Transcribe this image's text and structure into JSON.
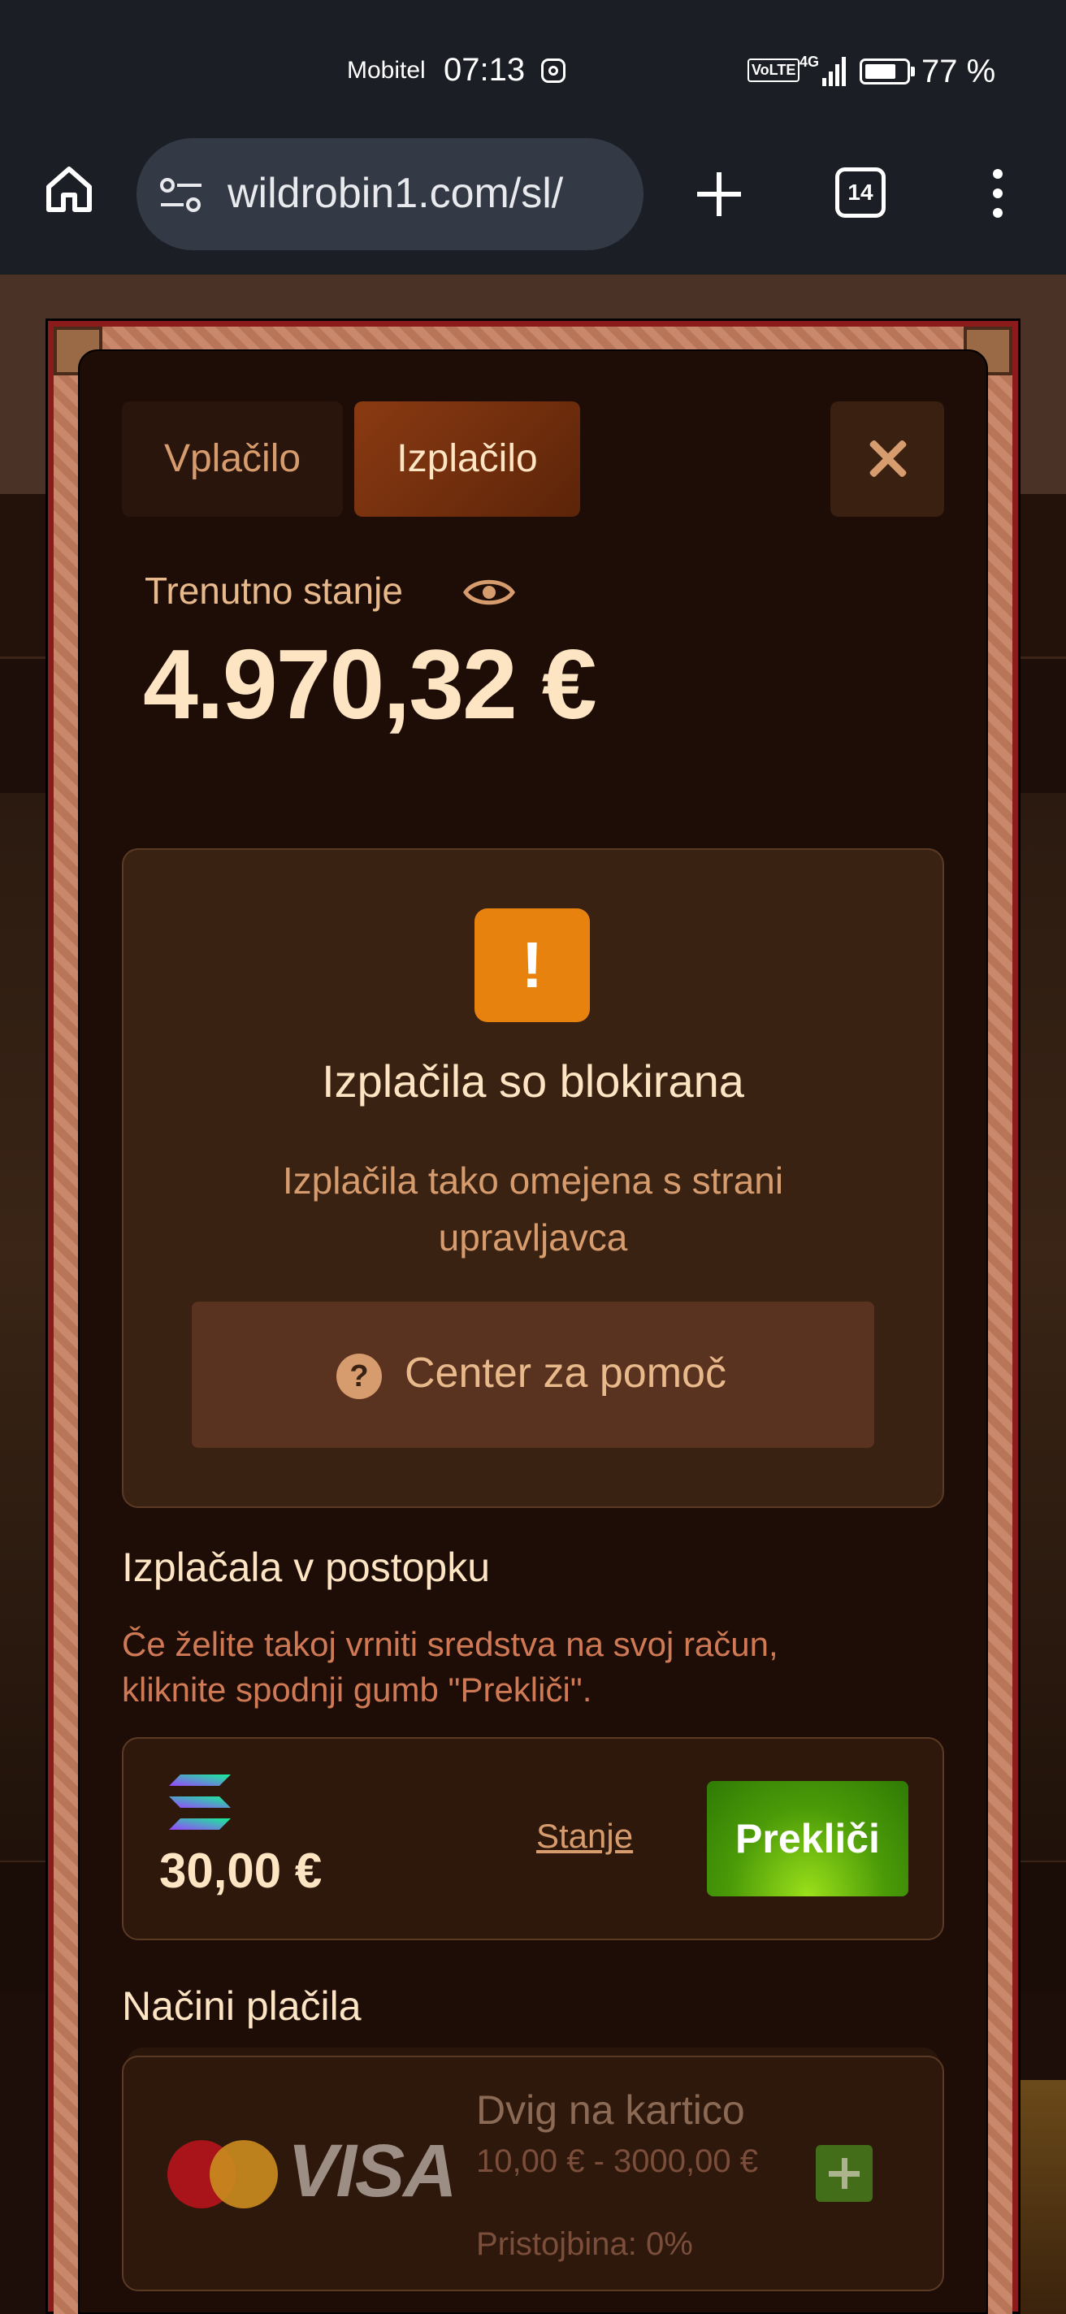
{
  "status_bar": {
    "carrier": "Mobitel",
    "time": "07:13",
    "network": "4G",
    "volte": "VoLTE",
    "battery_percent": 77,
    "battery_text": "77 %"
  },
  "browser": {
    "url": "wildrobin1.com/sl/",
    "tab_count": "14"
  },
  "modal": {
    "tabs": [
      {
        "label": "Vplačilo",
        "active": false
      },
      {
        "label": "Izplačilo",
        "active": true
      }
    ],
    "balance": {
      "label": "Trenutno stanje",
      "amount": "4.970,32 €"
    },
    "blocked": {
      "title": "Izplačila so blokirana",
      "description": "Izplačila tako omejena s strani upravljavca",
      "help_button": "Center za pomoč",
      "warn_symbol": "!"
    },
    "pending": {
      "title": "Izplačala v postopku",
      "description": "Če želite takoj vrniti sredstva na svoj račun, kliknite spodnji gumb \"Prekliči\".",
      "item": {
        "icon": "solana-icon",
        "amount": "30,00 €",
        "status_link": "Stanje",
        "cancel_label": "Prekliči"
      }
    },
    "payment_methods": {
      "title": "Načini plačila",
      "methods": [
        {
          "brand_text": "VISA",
          "name": "Dvig na kartico",
          "range": "10,00 € - 3000,00 €",
          "fee": "Pristojbina: 0%"
        }
      ]
    }
  },
  "colors": {
    "accent_orange": "#e8820e",
    "cancel_green": "#4a9a08",
    "text_cream": "#fde5c4",
    "text_tan": "#d79c6e"
  }
}
